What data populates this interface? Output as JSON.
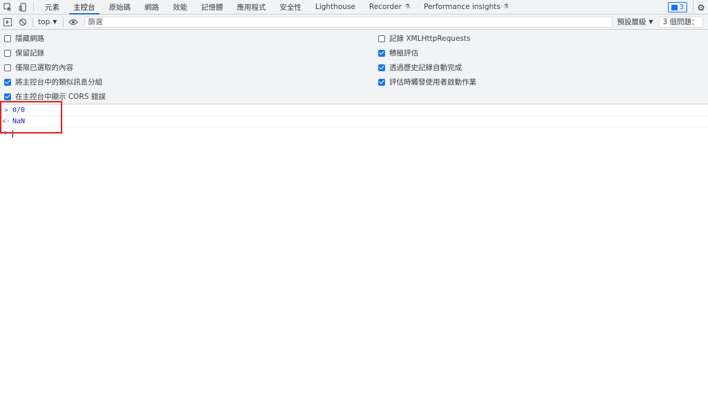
{
  "tabs": [
    {
      "label": "元素"
    },
    {
      "label": "主控台",
      "active": true
    },
    {
      "label": "原始碼"
    },
    {
      "label": "網路"
    },
    {
      "label": "效能"
    },
    {
      "label": "記憶體"
    },
    {
      "label": "應用程式"
    },
    {
      "label": "安全性"
    },
    {
      "label": "Lighthouse"
    },
    {
      "label": "Recorder"
    },
    {
      "label": "Performance insights"
    }
  ],
  "issues_badge": "3",
  "toolbar": {
    "context": "top",
    "filter_placeholder": "篩選",
    "levels": "預設層級",
    "issues": "3 個問題："
  },
  "settings": {
    "left": [
      {
        "label": "隱藏網路",
        "checked": false
      },
      {
        "label": "保留記錄",
        "checked": false
      },
      {
        "label": "僅限已選取的內容",
        "checked": false
      },
      {
        "label": "將主控台中的類似訊息分組",
        "checked": true
      },
      {
        "label": "在主控台中顯示 CORS 錯誤",
        "checked": true
      }
    ],
    "right": [
      {
        "label": "記錄 XMLHttpRequests",
        "checked": false
      },
      {
        "label": "積極評估",
        "checked": true
      },
      {
        "label": "透過歷史記錄自動完成",
        "checked": true
      },
      {
        "label": "評估時觸發使用者啟動作業",
        "checked": true
      }
    ]
  },
  "console": {
    "input": "0/0",
    "result": "NaN"
  },
  "colors": {
    "accent": "#1a73e8",
    "highlight": "#e02020"
  }
}
